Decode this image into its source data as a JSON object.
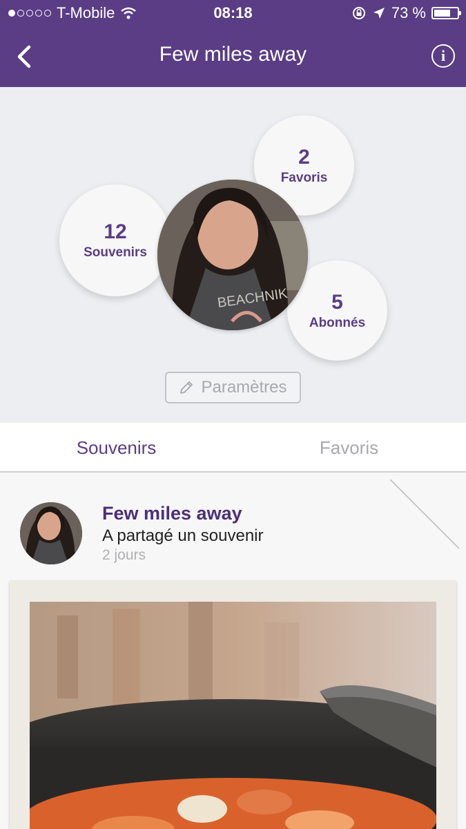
{
  "status_bar": {
    "carrier": "T-Mobile",
    "time": "08:18",
    "battery": "73 %",
    "battery_level": 0.73
  },
  "nav": {
    "title": "Few miles away"
  },
  "profile": {
    "stats": [
      {
        "value": "12",
        "label": "Souvenirs"
      },
      {
        "value": "2",
        "label": "Favoris"
      },
      {
        "value": "5",
        "label": "Abonnés"
      }
    ],
    "settings_label": "Paramètres"
  },
  "tabs": [
    {
      "label": "Souvenirs",
      "active": true
    },
    {
      "label": "Favoris",
      "active": false
    }
  ],
  "post": {
    "author": "Few miles away",
    "action": "A partagé un souvenir",
    "time": "2 jours"
  },
  "colors": {
    "brand": "#5a3d85",
    "background": "#eceef1"
  }
}
